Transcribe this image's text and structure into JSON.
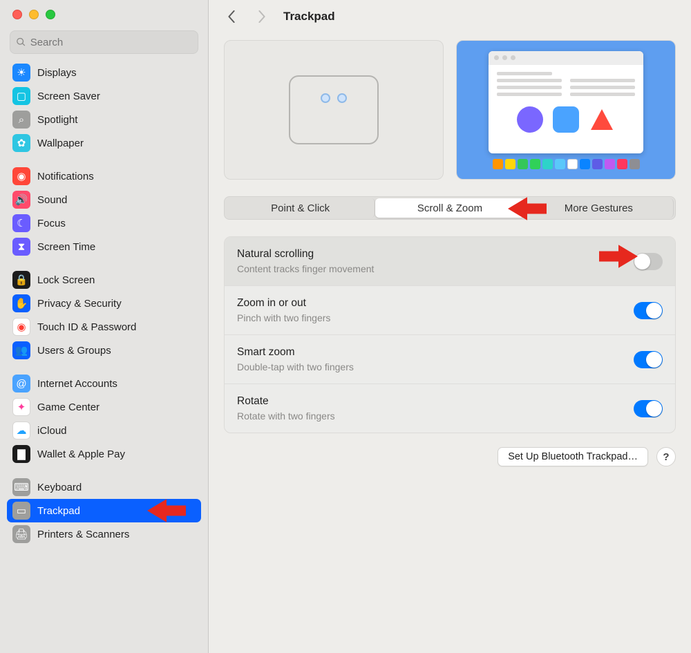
{
  "header": {
    "title": "Trackpad"
  },
  "search": {
    "placeholder": "Search"
  },
  "sidebar": {
    "items": [
      {
        "id": "displays",
        "label": "Displays",
        "iconBg": "#1b88ff",
        "glyph": "☀"
      },
      {
        "id": "screensaver",
        "label": "Screen Saver",
        "iconBg": "#14c4e3",
        "glyph": "▢"
      },
      {
        "id": "spotlight",
        "label": "Spotlight",
        "iconBg": "#9e9e9c",
        "glyph": "⌕"
      },
      {
        "id": "wallpaper",
        "label": "Wallpaper",
        "iconBg": "#2fc6e2",
        "glyph": "✿"
      },
      {
        "gap": true
      },
      {
        "id": "notifications",
        "label": "Notifications",
        "iconBg": "#ff4739",
        "glyph": "◉"
      },
      {
        "id": "sound",
        "label": "Sound",
        "iconBg": "#ff4a6b",
        "glyph": "🔊"
      },
      {
        "id": "focus",
        "label": "Focus",
        "iconBg": "#6a5cff",
        "glyph": "☾"
      },
      {
        "id": "screentime",
        "label": "Screen Time",
        "iconBg": "#6a5cff",
        "glyph": "⧗"
      },
      {
        "gap": true
      },
      {
        "id": "lockscreen",
        "label": "Lock Screen",
        "iconBg": "#1c1c1c",
        "glyph": "🔒"
      },
      {
        "id": "privacy",
        "label": "Privacy & Security",
        "iconBg": "#0a60ff",
        "glyph": "✋"
      },
      {
        "id": "touchid",
        "label": "Touch ID & Password",
        "iconBg": "#ffffff",
        "glyph": "◉",
        "glyphColor": "#ff3b30",
        "border": true
      },
      {
        "id": "users",
        "label": "Users & Groups",
        "iconBg": "#0a60ff",
        "glyph": "👥"
      },
      {
        "gap": true
      },
      {
        "id": "internet",
        "label": "Internet Accounts",
        "iconBg": "#4aa3ff",
        "glyph": "@"
      },
      {
        "id": "gamecenter",
        "label": "Game Center",
        "iconBg": "#ffffff",
        "glyph": "✦",
        "glyphColor": "#ff3b9c",
        "border": true
      },
      {
        "id": "icloud",
        "label": "iCloud",
        "iconBg": "#ffffff",
        "glyph": "☁",
        "glyphColor": "#1fa2ff",
        "border": true
      },
      {
        "id": "wallet",
        "label": "Wallet & Apple Pay",
        "iconBg": "#1c1c1c",
        "glyph": "▇"
      },
      {
        "gap": true
      },
      {
        "id": "keyboard",
        "label": "Keyboard",
        "iconBg": "#9e9e9c",
        "glyph": "⌨"
      },
      {
        "id": "trackpad",
        "label": "Trackpad",
        "iconBg": "#9e9e9c",
        "glyph": "▭",
        "selected": true
      },
      {
        "id": "printers",
        "label": "Printers & Scanners",
        "iconBg": "#9e9e9c",
        "glyph": "🖨"
      }
    ]
  },
  "tabs": [
    {
      "id": "point",
      "label": "Point & Click",
      "active": false
    },
    {
      "id": "scroll",
      "label": "Scroll & Zoom",
      "active": true
    },
    {
      "id": "gestures",
      "label": "More Gestures",
      "active": false
    }
  ],
  "settings": [
    {
      "id": "natural",
      "title": "Natural scrolling",
      "sub": "Content tracks finger movement",
      "on": false,
      "highlighted": true
    },
    {
      "id": "zoom",
      "title": "Zoom in or out",
      "sub": "Pinch with two fingers",
      "on": true
    },
    {
      "id": "smart",
      "title": "Smart zoom",
      "sub": "Double-tap with two fingers",
      "on": true
    },
    {
      "id": "rotate",
      "title": "Rotate",
      "sub": "Rotate with two fingers",
      "on": true
    }
  ],
  "buttons": {
    "setup": "Set Up Bluetooth Trackpad…",
    "help": "?"
  },
  "dockColors": [
    "#ff9500",
    "#ffd60a",
    "#34c759",
    "#30d158",
    "#2ed3c9",
    "#5ac8fa",
    "#ffffff",
    "#0a84ff",
    "#5e5ce6",
    "#bf5af2",
    "#ff375f",
    "#8e8e93"
  ]
}
